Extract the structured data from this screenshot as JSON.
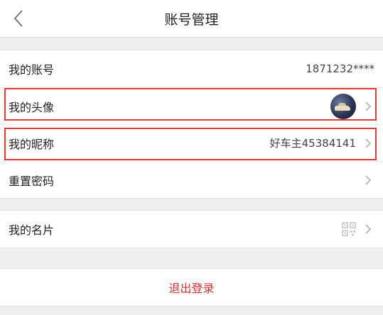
{
  "header": {
    "title": "账号管理",
    "back_icon": "back-chevron-icon"
  },
  "account": {
    "my_account_label": "我的账号",
    "my_account_value": "1871232****",
    "avatar_label": "我的头像",
    "nickname_label": "我的昵称",
    "nickname_value": "好车主45384141",
    "reset_password_label": "重置密码"
  },
  "card": {
    "label": "我的名片",
    "icon": "qr-code-icon"
  },
  "logout": {
    "label": "退出登录"
  },
  "colors": {
    "accent": "#d32f2f",
    "highlight": "#e53935"
  }
}
